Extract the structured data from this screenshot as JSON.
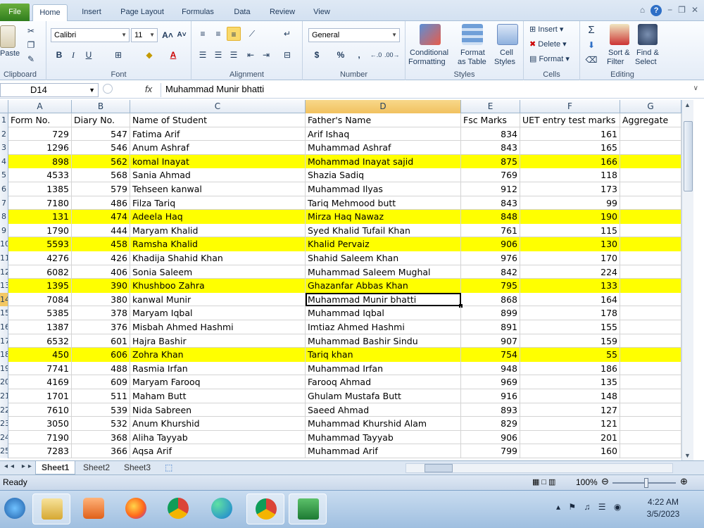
{
  "ribbon": {
    "file_tab": "File",
    "tabs": [
      "Home",
      "Insert",
      "Page Layout",
      "Formulas",
      "Data",
      "Review",
      "View"
    ],
    "active_tab": "Home",
    "groups": {
      "clipboard": "Clipboard",
      "font": "Font",
      "alignment": "Alignment",
      "number": "Number",
      "styles": "Styles",
      "cells": "Cells",
      "editing": "Editing"
    },
    "paste_label": "Paste",
    "font_name": "Calibri",
    "font_size": "11",
    "number_format": "General",
    "conditional_formatting": [
      "Conditional",
      "Formatting"
    ],
    "format_as_table": [
      "Format",
      "as Table"
    ],
    "cell_styles": [
      "Cell",
      "Styles"
    ],
    "insert": "Insert",
    "delete": "Delete",
    "format": "Format",
    "sort_filter": [
      "Sort &",
      "Filter"
    ],
    "find_select": [
      "Find &",
      "Select"
    ],
    "bold": "B",
    "italic": "I",
    "underline": "U",
    "currency": "$",
    "percent": "%",
    "comma": ","
  },
  "formula_bar": {
    "name_box": "D14",
    "fx": "fx",
    "content": "Muhammad Munir bhatti"
  },
  "columns": [
    "A",
    "B",
    "C",
    "D",
    "E",
    "F",
    "G"
  ],
  "header_row": [
    "Form No.",
    "Diary No.",
    "Name of Student",
    "Father's Name",
    "Fsc Marks",
    "UET entry test marks",
    "Aggregate"
  ],
  "rows": [
    {
      "n": "2",
      "form": "729",
      "diary": "547",
      "name": "Fatima Arif",
      "father": "Arif Ishaq",
      "fsc": "834",
      "uet": "161",
      "hl": false
    },
    {
      "n": "3",
      "form": "1296",
      "diary": "546",
      "name": "Anum Ashraf",
      "father": "Muhammad Ashraf",
      "fsc": "843",
      "uet": "165",
      "hl": false
    },
    {
      "n": "4",
      "form": "898",
      "diary": "562",
      "name": "komal Inayat",
      "father": "Mohammad Inayat sajid",
      "fsc": "875",
      "uet": "166",
      "hl": true
    },
    {
      "n": "5",
      "form": "4533",
      "diary": "568",
      "name": "Sania Ahmad",
      "father": "Shazia Sadiq",
      "fsc": "769",
      "uet": "118",
      "hl": false
    },
    {
      "n": "6",
      "form": "1385",
      "diary": "579",
      "name": "Tehseen kanwal",
      "father": "Muhammad Ilyas",
      "fsc": "912",
      "uet": "173",
      "hl": false
    },
    {
      "n": "7",
      "form": "7180",
      "diary": "486",
      "name": "Filza Tariq",
      "father": "Tariq Mehmood butt",
      "fsc": "843",
      "uet": "99",
      "hl": false
    },
    {
      "n": "8",
      "form": "131",
      "diary": "474",
      "name": "Adeela Haq",
      "father": "Mirza Haq Nawaz",
      "fsc": "848",
      "uet": "190",
      "hl": true
    },
    {
      "n": "9",
      "form": "1790",
      "diary": "444",
      "name": "Maryam Khalid",
      "father": "Syed Khalid Tufail Khan",
      "fsc": "761",
      "uet": "115",
      "hl": false
    },
    {
      "n": "10",
      "form": "5593",
      "diary": "458",
      "name": "Ramsha Khalid",
      "father": "Khalid Pervaiz",
      "fsc": "906",
      "uet": "130",
      "hl": true
    },
    {
      "n": "11",
      "form": "4276",
      "diary": "426",
      "name": "Khadija Shahid Khan",
      "father": "Shahid Saleem Khan",
      "fsc": "976",
      "uet": "170",
      "hl": false
    },
    {
      "n": "12",
      "form": "6082",
      "diary": "406",
      "name": "Sonia Saleem",
      "father": "Muhammad Saleem Mughal",
      "fsc": "842",
      "uet": "224",
      "hl": false
    },
    {
      "n": "13",
      "form": "1395",
      "diary": "390",
      "name": "Khushboo Zahra",
      "father": "Ghazanfar Abbas Khan",
      "fsc": "795",
      "uet": "133",
      "hl": true
    },
    {
      "n": "14",
      "form": "7084",
      "diary": "380",
      "name": "kanwal Munir",
      "father": "Muhammad Munir bhatti",
      "fsc": "868",
      "uet": "164",
      "hl": false
    },
    {
      "n": "15",
      "form": "5385",
      "diary": "378",
      "name": "Maryam Iqbal",
      "father": "Muhammad Iqbal",
      "fsc": "899",
      "uet": "178",
      "hl": false
    },
    {
      "n": "16",
      "form": "1387",
      "diary": "376",
      "name": "Misbah Ahmed Hashmi",
      "father": "Imtiaz Ahmed Hashmi",
      "fsc": "891",
      "uet": "155",
      "hl": false
    },
    {
      "n": "17",
      "form": "6532",
      "diary": "601",
      "name": "Hajra Bashir",
      "father": "Muhammad Bashir Sindu",
      "fsc": "907",
      "uet": "159",
      "hl": false
    },
    {
      "n": "18",
      "form": "450",
      "diary": "606",
      "name": "Zohra Khan",
      "father": "Tariq khan",
      "fsc": "754",
      "uet": "55",
      "hl": true
    },
    {
      "n": "19",
      "form": "7741",
      "diary": "488",
      "name": "Rasmia Irfan",
      "father": "Muhammad Irfan",
      "fsc": "948",
      "uet": "186",
      "hl": false
    },
    {
      "n": "20",
      "form": "4169",
      "diary": "609",
      "name": "Maryam Farooq",
      "father": "Farooq Ahmad",
      "fsc": "969",
      "uet": "135",
      "hl": false
    },
    {
      "n": "21",
      "form": "1701",
      "diary": "511",
      "name": "Maham Butt",
      "father": "Ghulam Mustafa Butt",
      "fsc": "916",
      "uet": "148",
      "hl": false
    },
    {
      "n": "22",
      "form": "7610",
      "diary": "539",
      "name": "Nida Sabreen",
      "father": "Saeed Ahmad",
      "fsc": "893",
      "uet": "127",
      "hl": false
    },
    {
      "n": "23",
      "form": "3050",
      "diary": "532",
      "name": "Anum Khurshid",
      "father": "Muhammad Khurshid Alam",
      "fsc": "829",
      "uet": "121",
      "hl": false
    },
    {
      "n": "24",
      "form": "7190",
      "diary": "368",
      "name": "Aliha Tayyab",
      "father": "Muhammad Tayyab",
      "fsc": "906",
      "uet": "201",
      "hl": false
    },
    {
      "n": "25",
      "form": "7283",
      "diary": "366",
      "name": "Aqsa Arif",
      "father": "Muhammad Arif",
      "fsc": "799",
      "uet": "160",
      "hl": false
    }
  ],
  "active_cell": "D14",
  "highlight_color": "#ffff00",
  "sheets": [
    "Sheet1",
    "Sheet2",
    "Sheet3"
  ],
  "active_sheet": "Sheet1",
  "status": {
    "ready": "Ready",
    "zoom": "100%"
  },
  "taskbar": {
    "apps": [
      "windows-start",
      "file-explorer",
      "media-player",
      "firefox",
      "chrome",
      "edge",
      "chrome-profile",
      "excel"
    ],
    "time": "4:22 AM",
    "date": "3/5/2023"
  }
}
